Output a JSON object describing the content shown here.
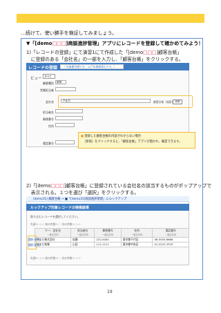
{
  "intro": "…続けて、使い勝手を検証してみましょう。",
  "heading": {
    "prefix": "▼「[demo",
    "mark": "□□□",
    "suffix": "]商談進捗管理」アプリにレコードを登録して確かめてみよう！"
  },
  "step1": {
    "line1_a": "1)「レコードの登録」にて演習1にて作成した「[demo",
    "line1_mark": "□□□",
    "line1_b": "]顧客台帳」",
    "line2": "　に登録のある「会社名」の一部を入力し、「顧客台帳」をクリックする。"
  },
  "screenshot1": {
    "title": "レコードの登録",
    "badge": "（ 社員番号順です。 以下年齢順表示です。）",
    "view_label": "ビュー",
    "view_value": "すべて",
    "fields": [
      {
        "label": "顧客種別",
        "value": "新規"
      },
      {
        "label": "営業担当者",
        "value": ""
      },
      {
        "label": "会社名",
        "value": "やまだ"
      },
      {
        "label": "担当者名",
        "value": ""
      },
      {
        "label": "郵便番号",
        "value": ""
      },
      {
        "label": "住所",
        "value": ""
      },
      {
        "label": "電話番号",
        "value": ""
      }
    ],
    "lookup_label": "顧客台帳（検索）",
    "ref_button": "参照"
  },
  "info": {
    "line1": "登録した顧客台帳の内容がわからない場合",
    "line2": "［参照］をクリックすると、「顧客台帳」アプリが開かれ、確認できます。"
  },
  "step2": {
    "line1_a": "2)「[demo",
    "line1_mark": "□□□",
    "line1_b": "]顧客台帳」に登録されている会社名の該当するものがポップアップで",
    "line2": "　表示される。１つを選び「選択」をクリックする。"
  },
  "screenshot2": {
    "top": "(demo31) 顧客台帳 → ■「[demo31]商談進捗管理」にルックアップ",
    "title": "ルックアップ対象レコードの検索結果",
    "note": "取り込むレコードを選択してください。",
    "pagination": "先頭へ ＜＜ 前の件数へ｜ 次の件数へ ＞＞",
    "columns": [
      {
        "label": "キー：会社名",
        "sub": "一致文字列"
      },
      {
        "label": "担当者名",
        "sub": "一致文字列"
      },
      {
        "label": "郵便番号",
        "sub": "一致文字列"
      },
      {
        "label": "住所",
        "sub": "一致文字列"
      },
      {
        "label": "電話番号",
        "sub": "一致文字列"
      }
    ],
    "rows": [
      {
        "select": "選択 参照",
        "cells": [
          "やまだ株式会社",
          "佐藤",
          "222-0000",
          "東京都千代区",
          "06-5555-6666"
        ]
      },
      {
        "select": "選択 参照",
        "cells": [
          "やまだ商事",
          "山田",
          "111-1111",
          "東京都中央区",
          "01-2222-3333"
        ]
      }
    ]
  },
  "page_number": "19",
  "colors": {
    "accent_yellow": "#fcd23a",
    "header_blue": "#3f7cc2",
    "highlight": "#f5c242",
    "red": "#e0304a"
  }
}
